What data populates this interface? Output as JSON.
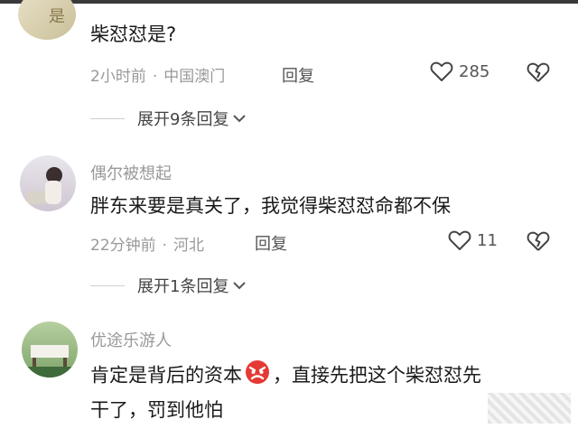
{
  "comments": [
    {
      "text": "柴怼怼是?",
      "time": "2小时前",
      "location": "中国澳门",
      "reply_label": "回复",
      "likes": "285",
      "expand_label": "展开9条回复"
    },
    {
      "username": "偶尔被想起",
      "text": "胖东来要是真关了，我觉得柴怼怼命都不保",
      "time": "22分钟前",
      "location": "河北",
      "reply_label": "回复",
      "likes": "11",
      "expand_label": "展开1条回复"
    },
    {
      "username": "优途乐游人",
      "text_line1a": "肯定是背后的资本",
      "text_line1b": "，直接先把这个柴怼怼先",
      "text_line2": "干了，罚到他怕"
    }
  ],
  "icons": {
    "like": "heart-icon",
    "dislike": "broken-heart-icon",
    "expand": "chevron-down-icon",
    "emoji": "angry-face-emoji"
  },
  "colors": {
    "meta": "#999999",
    "text": "#1a1a1a",
    "emoji": "#e53935"
  }
}
